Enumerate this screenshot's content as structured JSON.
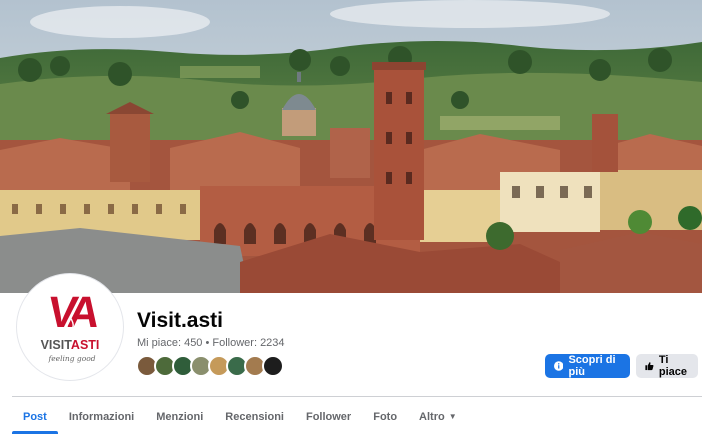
{
  "page": {
    "name": "Visit.asti",
    "stats": "Mi piace: 450 • Follower: 2234"
  },
  "logo": {
    "mark": "VA",
    "brand_left": "VISIT",
    "brand_right": "ASTI",
    "tagline": "feeling good"
  },
  "actions": {
    "primary_label": "Scopri di più",
    "secondary_label": "Ti piace"
  },
  "tabs": [
    {
      "label": "Post"
    },
    {
      "label": "Informazioni"
    },
    {
      "label": "Menzioni"
    },
    {
      "label": "Recensioni"
    },
    {
      "label": "Follower"
    },
    {
      "label": "Foto"
    },
    {
      "label": "Altro"
    }
  ],
  "friends": [
    "#7a5a3c",
    "#4d6a3a",
    "#2f5d3a",
    "#8a8f6d",
    "#c59a5a",
    "#3a6b4a",
    "#a37b4f",
    "#1d1d1d"
  ],
  "colors": {
    "accent": "#1b74e4",
    "brand_red": "#c8102e",
    "text": "#050505",
    "muted": "#65676b"
  }
}
